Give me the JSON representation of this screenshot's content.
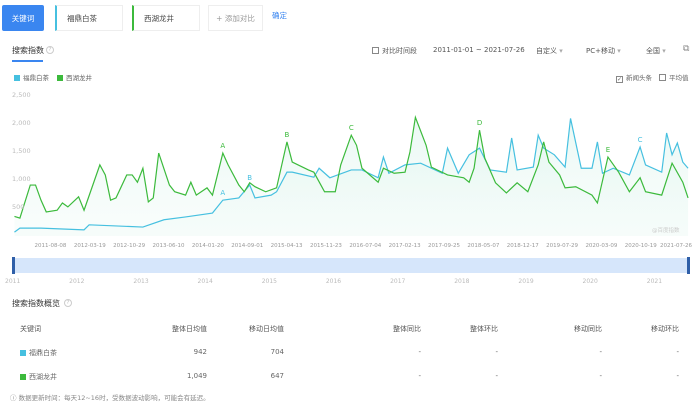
{
  "toolbar": {
    "keyword_button": "关键词",
    "keywords": [
      "福鼎白茶",
      "西湖龙井"
    ],
    "add_compare": "+ 添加对比",
    "confirm": "确定"
  },
  "trend": {
    "title": "搜索指数",
    "compare_period": "对比时间段",
    "date_range": "2011-01-01 ~ 2021-07-26",
    "custom": "自定义",
    "platform": "PC+移动",
    "region": "全国",
    "news_headline": "新闻头条",
    "news_headline_checked": true,
    "average": "平均值",
    "average_checked": false,
    "watermark": "@百度指数"
  },
  "colors": {
    "accent": "#3a86f0",
    "series1": "#46c0e0",
    "series2": "#3cba3c"
  },
  "chart_data": {
    "type": "line",
    "xlim": [
      "2011-01-01",
      "2021-07-26"
    ],
    "ylim": [
      0,
      2500
    ],
    "yticks": [
      "500",
      "1,000",
      "1,500",
      "2,000",
      "2,500"
    ],
    "xticks": [
      "2011-08-08",
      "2012-03-19",
      "2012-10-29",
      "2013-06-10",
      "2014-01-20",
      "2014-09-01",
      "2015-04-13",
      "2015-11-23",
      "2016-07-04",
      "2017-02-13",
      "2017-09-25",
      "2018-05-07",
      "2018-12-17",
      "2019-07-29",
      "2020-03-09",
      "2020-10-19",
      "2021-07-26"
    ],
    "grid": false,
    "legend_placement": "top-left",
    "series": [
      {
        "name": "福鼎白茶",
        "color": "#46c0e0",
        "points": [
          [
            "2011-01",
            70
          ],
          [
            "2011-02",
            140
          ],
          [
            "2011-06",
            140
          ],
          [
            "2012-02",
            110
          ],
          [
            "2012-03",
            200
          ],
          [
            "2013-01",
            160
          ],
          [
            "2013-05",
            290
          ],
          [
            "2013-09",
            340
          ],
          [
            "2014-02",
            410
          ],
          [
            "2014-04",
            640
          ],
          [
            "2014-07",
            680
          ],
          [
            "2014-09",
            910
          ],
          [
            "2014-10",
            680
          ],
          [
            "2015-01",
            730
          ],
          [
            "2015-02",
            790
          ],
          [
            "2015-04",
            1140
          ],
          [
            "2015-05",
            1140
          ],
          [
            "2015-09",
            1050
          ],
          [
            "2015-10",
            1210
          ],
          [
            "2015-12",
            1040
          ],
          [
            "2016-04",
            1180
          ],
          [
            "2016-06",
            1180
          ],
          [
            "2016-09",
            1040
          ],
          [
            "2016-10",
            1410
          ],
          [
            "2016-11",
            1120
          ],
          [
            "2017-02",
            1270
          ],
          [
            "2017-05",
            1300
          ],
          [
            "2017-09",
            1120
          ],
          [
            "2017-10",
            1570
          ],
          [
            "2017-12",
            1120
          ],
          [
            "2018-02",
            1450
          ],
          [
            "2018-04",
            1570
          ],
          [
            "2018-06",
            1180
          ],
          [
            "2018-09",
            1140
          ],
          [
            "2018-10",
            1750
          ],
          [
            "2018-11",
            1180
          ],
          [
            "2019-02",
            1230
          ],
          [
            "2019-03",
            1800
          ],
          [
            "2019-04",
            1570
          ],
          [
            "2019-06",
            1450
          ],
          [
            "2019-08",
            1230
          ],
          [
            "2019-09",
            2100
          ],
          [
            "2019-11",
            1210
          ],
          [
            "2020-01",
            1210
          ],
          [
            "2020-02",
            1680
          ],
          [
            "2020-03",
            1120
          ],
          [
            "2020-05",
            1210
          ],
          [
            "2020-08",
            1090
          ],
          [
            "2020-10",
            1590
          ],
          [
            "2020-11",
            1270
          ],
          [
            "2021-02",
            1140
          ],
          [
            "2021-03",
            1840
          ],
          [
            "2021-04",
            1450
          ],
          [
            "2021-05",
            1660
          ],
          [
            "2021-06",
            1320
          ],
          [
            "2021-07",
            1210
          ]
        ]
      },
      {
        "name": "西湖龙井",
        "color": "#3cba3c",
        "points": [
          [
            "2011-01",
            350
          ],
          [
            "2011-02",
            320
          ],
          [
            "2011-04",
            910
          ],
          [
            "2011-05",
            910
          ],
          [
            "2011-06",
            640
          ],
          [
            "2011-07",
            430
          ],
          [
            "2011-09",
            460
          ],
          [
            "2011-10",
            590
          ],
          [
            "2011-11",
            520
          ],
          [
            "2012-01",
            700
          ],
          [
            "2012-02",
            460
          ],
          [
            "2012-05",
            1270
          ],
          [
            "2012-06",
            1090
          ],
          [
            "2012-07",
            640
          ],
          [
            "2012-08",
            680
          ],
          [
            "2012-10",
            1090
          ],
          [
            "2012-11",
            1090
          ],
          [
            "2012-12",
            960
          ],
          [
            "2013-01",
            1210
          ],
          [
            "2013-02",
            610
          ],
          [
            "2013-03",
            680
          ],
          [
            "2013-04",
            1480
          ],
          [
            "2013-06",
            910
          ],
          [
            "2013-07",
            790
          ],
          [
            "2013-09",
            730
          ],
          [
            "2013-10",
            960
          ],
          [
            "2013-11",
            730
          ],
          [
            "2014-01",
            860
          ],
          [
            "2014-02",
            730
          ],
          [
            "2014-04",
            1480
          ],
          [
            "2014-05",
            1270
          ],
          [
            "2014-07",
            910
          ],
          [
            "2014-08",
            790
          ],
          [
            "2014-09",
            950
          ],
          [
            "2014-10",
            880
          ],
          [
            "2014-12",
            790
          ],
          [
            "2015-02",
            860
          ],
          [
            "2015-04",
            1680
          ],
          [
            "2015-05",
            1320
          ],
          [
            "2015-08",
            1180
          ],
          [
            "2015-09",
            1140
          ],
          [
            "2015-11",
            790
          ],
          [
            "2016-01",
            790
          ],
          [
            "2016-02",
            1270
          ],
          [
            "2016-04",
            1800
          ],
          [
            "2016-05",
            1620
          ],
          [
            "2016-06",
            1210
          ],
          [
            "2016-09",
            960
          ],
          [
            "2016-10",
            1210
          ],
          [
            "2016-12",
            1120
          ],
          [
            "2017-02",
            1140
          ],
          [
            "2017-03",
            1500
          ],
          [
            "2017-04",
            2120
          ],
          [
            "2017-06",
            1620
          ],
          [
            "2017-07",
            1230
          ],
          [
            "2017-10",
            1090
          ],
          [
            "2018-01",
            1040
          ],
          [
            "2018-02",
            960
          ],
          [
            "2018-03",
            1210
          ],
          [
            "2018-04",
            1890
          ],
          [
            "2018-05",
            1390
          ],
          [
            "2018-07",
            950
          ],
          [
            "2018-09",
            770
          ],
          [
            "2018-11",
            950
          ],
          [
            "2019-01",
            790
          ],
          [
            "2019-03",
            1270
          ],
          [
            "2019-04",
            1680
          ],
          [
            "2019-05",
            1320
          ],
          [
            "2019-07",
            1090
          ],
          [
            "2019-08",
            860
          ],
          [
            "2019-10",
            880
          ],
          [
            "2020-01",
            730
          ],
          [
            "2020-02",
            590
          ],
          [
            "2020-04",
            1410
          ],
          [
            "2020-06",
            1140
          ],
          [
            "2020-08",
            790
          ],
          [
            "2020-10",
            1040
          ],
          [
            "2020-11",
            790
          ],
          [
            "2021-02",
            730
          ],
          [
            "2021-04",
            1300
          ],
          [
            "2021-06",
            960
          ],
          [
            "2021-07",
            680
          ]
        ]
      }
    ],
    "annotations": [
      {
        "label": "A",
        "series": 1,
        "x": "2014-04"
      },
      {
        "label": "A",
        "series": 0,
        "x": "2014-04"
      },
      {
        "label": "B",
        "series": 0,
        "x": "2014-09"
      },
      {
        "label": "B",
        "series": 1,
        "x": "2015-04"
      },
      {
        "label": "C",
        "series": 1,
        "x": "2016-04"
      },
      {
        "label": "D",
        "series": 1,
        "x": "2018-04"
      },
      {
        "label": "E",
        "series": 1,
        "x": "2020-04"
      },
      {
        "label": "C",
        "series": 0,
        "x": "2020-10"
      }
    ]
  },
  "slider": {
    "years": [
      "2011",
      "2012",
      "2013",
      "2014",
      "2015",
      "2016",
      "2017",
      "2018",
      "2019",
      "2020",
      "2021"
    ]
  },
  "overview": {
    "title": "搜索指数概览",
    "headers": [
      "关键词",
      "整体日均值",
      "移动日均值",
      "整体同比",
      "整体环比",
      "移动同比",
      "移动环比"
    ],
    "rows": [
      {
        "keyword": "福鼎白茶",
        "color": "#46c0e0",
        "cells": [
          "942",
          "704",
          "-",
          "-",
          "-",
          "-"
        ]
      },
      {
        "keyword": "西湖龙井",
        "color": "#3cba3c",
        "cells": [
          "1,049",
          "647",
          "-",
          "-",
          "-",
          "-"
        ]
      }
    ],
    "footnote": "数据更新时间：每天12~16时，受数据波动影响，可能会有延迟。"
  }
}
